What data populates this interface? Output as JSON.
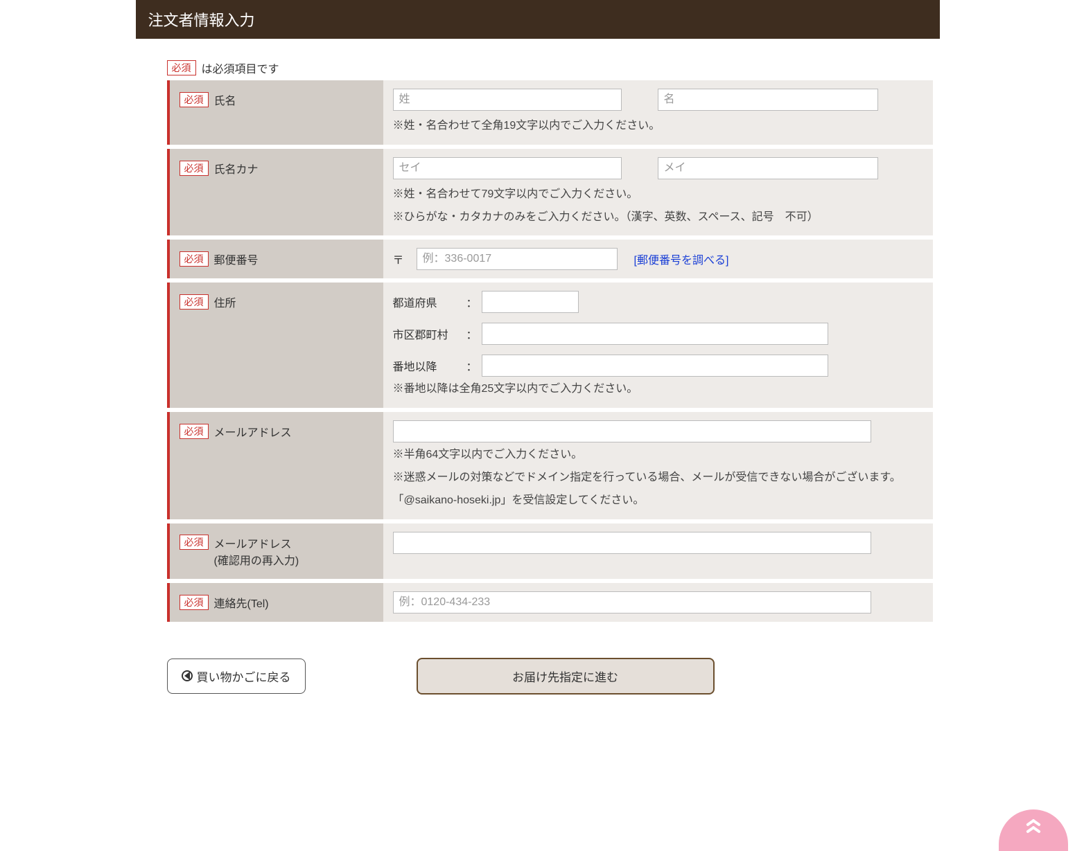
{
  "section_title": "注文者情報入力",
  "legend_badge": "必須",
  "legend_text": "は必須項目です",
  "fields": {
    "name": {
      "label": "氏名",
      "sei_placeholder": "姓",
      "mei_placeholder": "名",
      "note": "※姓・名合わせて全角19文字以内でご入力ください。"
    },
    "kana": {
      "label": "氏名カナ",
      "sei_placeholder": "セイ",
      "mei_placeholder": "メイ",
      "note1": "※姓・名合わせて79文字以内でご入力ください。",
      "note2": "※ひらがな・カタカナのみをご入力ください。（漢字、英数、スペース、記号　不可）"
    },
    "zip": {
      "label": "郵便番号",
      "mark": "〒",
      "placeholder": "例：336-0017",
      "link": "[郵便番号を調べる]"
    },
    "address": {
      "label": "住所",
      "pref_label": "都道府県",
      "city_label": "市区郡町村",
      "street_label": "番地以降",
      "colon": "：",
      "note": "※番地以降は全角25文字以内でご入力ください。"
    },
    "email": {
      "label": "メールアドレス",
      "note1": "※半角64文字以内でご入力ください。",
      "note2": "※迷惑メールの対策などでドメイン指定を行っている場合、メールが受信できない場合がございます。",
      "note3": "「@saikano-hoseki.jp」を受信設定してください。"
    },
    "email_confirm": {
      "label1": "メールアドレス",
      "label2": "(確認用の再入力)"
    },
    "tel": {
      "label": "連絡先(Tel)",
      "placeholder": "例：0120-434-233"
    }
  },
  "buttons": {
    "back": "買い物かごに戻る",
    "next": "お届け先指定に進む"
  }
}
